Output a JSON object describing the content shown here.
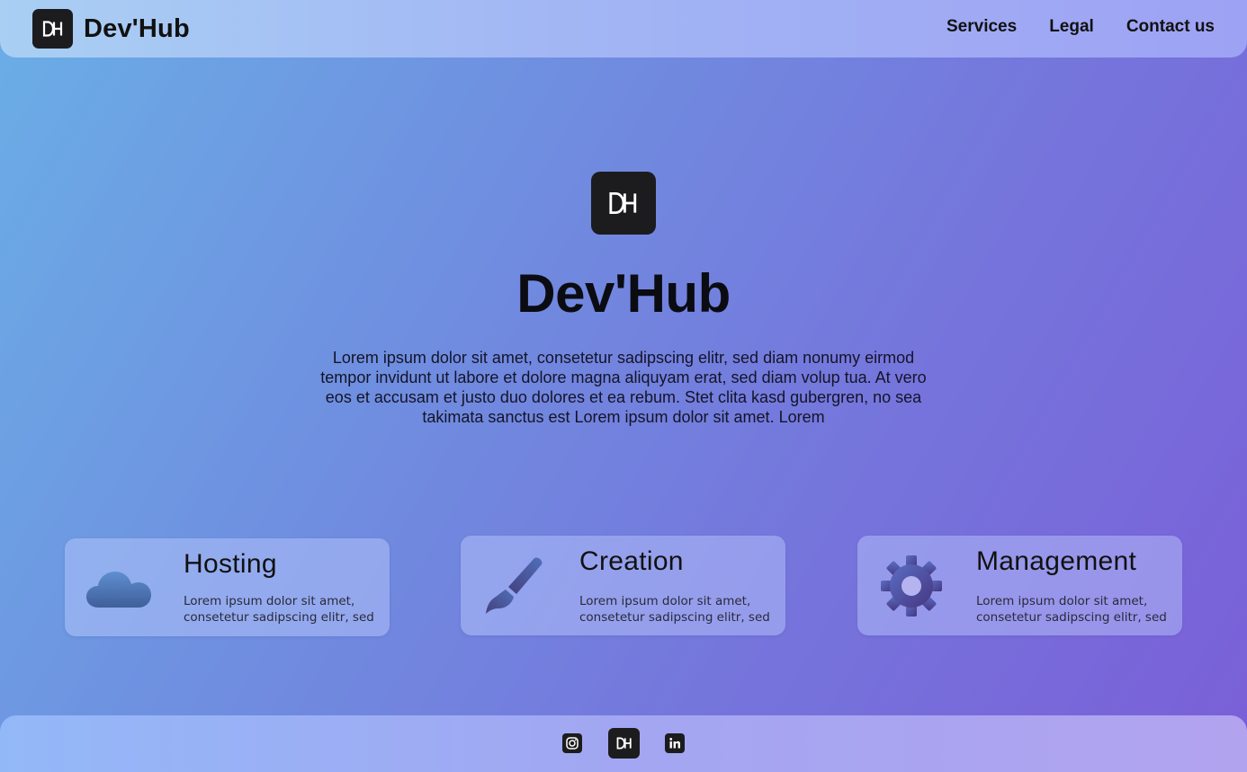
{
  "header": {
    "logo_icon": "dh-logo-icon",
    "brand": "Dev'Hub",
    "nav": [
      {
        "label": "Services"
      },
      {
        "label": "Legal"
      },
      {
        "label": "Contact us"
      }
    ]
  },
  "hero": {
    "logo_icon": "dh-logo-icon",
    "title": "Dev'Hub",
    "description": "Lorem ipsum dolor sit amet, consetetur sadipscing elitr, sed diam nonumy eirmod tempor invidunt ut labore et dolore magna aliquyam erat, sed diam volup tua. At vero eos et accusam et justo duo dolores et ea rebum. Stet clita kasd gubergren, no sea takimata sanctus est Lorem ipsum dolor sit amet. Lorem"
  },
  "services": [
    {
      "icon": "cloud-icon",
      "title": "Hosting",
      "text": "Lorem ipsum dolor sit amet, consetetur sadipscing elitr, sed"
    },
    {
      "icon": "paintbrush-icon",
      "title": "Creation",
      "text": "Lorem ipsum dolor sit amet, consetetur sadipscing elitr, sed"
    },
    {
      "icon": "gear-icon",
      "title": "Management",
      "text": "Lorem ipsum dolor sit amet, consetetur sadipscing elitr, sed"
    }
  ],
  "footer": {
    "social": [
      {
        "icon": "instagram-icon"
      },
      {
        "icon": "dh-logo-icon"
      },
      {
        "icon": "linkedin-icon"
      }
    ]
  },
  "colors": {
    "background_start": "#6aaee6",
    "background_end": "#7a5fd8",
    "logo_bg": "#1c1c1e",
    "text": "#111111",
    "icon_gradient_start": "#5a86c8",
    "icon_gradient_end": "#4a3f8a"
  }
}
